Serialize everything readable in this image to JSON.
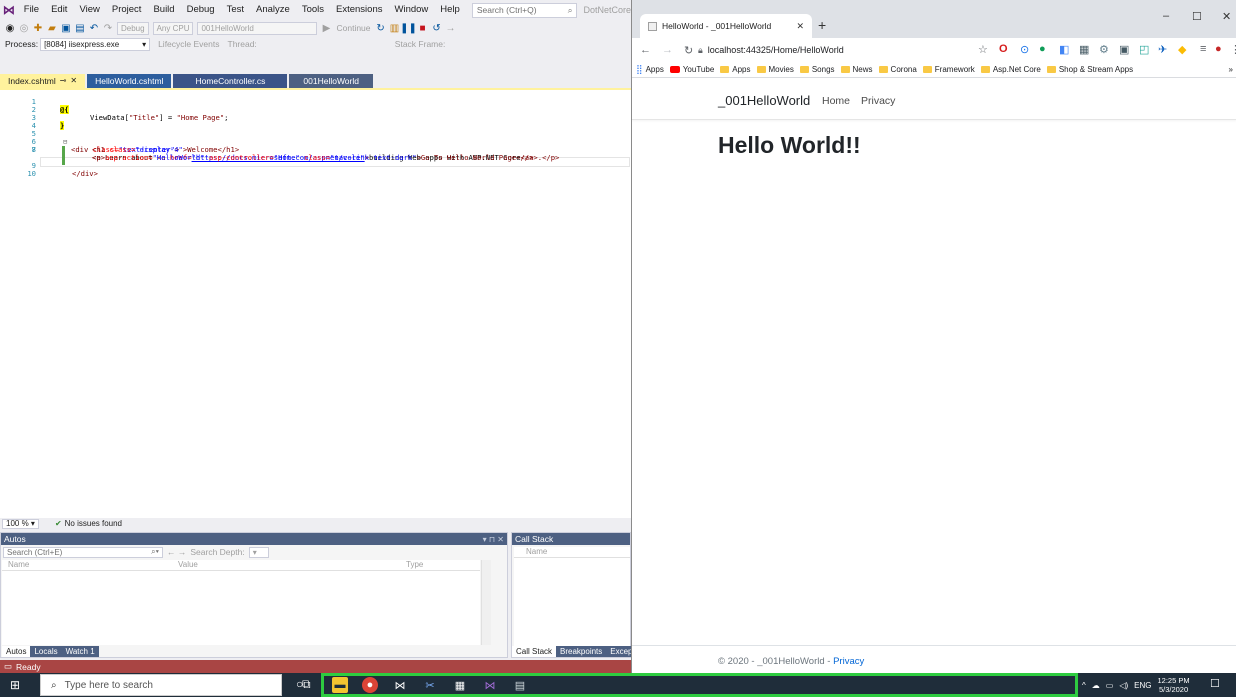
{
  "vs": {
    "menu": [
      "File",
      "Edit",
      "View",
      "Project",
      "Build",
      "Debug",
      "Test",
      "Analyze",
      "Tools",
      "Extensions",
      "Window",
      "Help"
    ],
    "search_placeholder": "Search (Ctrl+Q)",
    "solution_name": "DotNetCore",
    "toolbar": {
      "config": "Debug",
      "platform": "Any CPU",
      "project": "001HelloWorld",
      "continue_label": "Continue",
      "stack_frame": "Stack Frame:"
    },
    "debugbar": {
      "process_label": "Process:",
      "process_value": "[8084] iisexpress.exe",
      "lifecycle": "Lifecycle Events",
      "thread": "Thread:"
    },
    "tabs": [
      "Index.cshtml",
      "HelloWorld.cshtml",
      "HomeController.cs",
      "001HelloWorld"
    ],
    "code": {
      "l1": "@{",
      "l2a": "ViewData[",
      "l2b": "\"Title\"",
      "l2c": "] = ",
      "l2d": "\"Home Page\"",
      "l2e": ";",
      "l3": "}",
      "l5a": "<div ",
      "l5b": "class=",
      "l5c": "\"text-center\"",
      "l5d": ">",
      "l6a": "<h1 ",
      "l6b": "class=",
      "l6c": "\"display-4\"",
      "l6d": ">Welcome</h1>",
      "l7a": "<p>",
      "l7b": "Learn about ",
      "l7c": "<a ",
      "l7d": "href=",
      "l7e": "\"https://docs.microsoft.com/aspnet/core\"",
      "l7f": ">",
      "l7g": "building Web apps with ASP.NET Core",
      "l7h": "</a>.</p>",
      "l8a": "<a ",
      "l8b": "asp-action=",
      "l8c": "\"HelloWorld\"",
      "l8d": " asp-controller=",
      "l8e": "\"Home\"",
      "l8f": " class=",
      "l8g": "\"nav-link text-dark\"",
      "l8h": ">Go To Hello World Page</a>",
      "l9": "</div>"
    },
    "line_numbers": [
      "1",
      "2",
      "3",
      "4",
      "5",
      "6",
      "7",
      "8",
      "9",
      "10"
    ],
    "zoom": "100 %",
    "issues": "No issues found",
    "autos": {
      "title": "Autos",
      "search_placeholder": "Search (Ctrl+E)",
      "search_depth": "Search Depth:",
      "columns": [
        "Name",
        "Value",
        "Type"
      ]
    },
    "callstack": {
      "title": "Call Stack",
      "column": "Name"
    },
    "bottom_tabs_left": [
      "Autos",
      "Locals",
      "Watch 1"
    ],
    "bottom_tabs_right": [
      "Call Stack",
      "Breakpoints",
      "Exceptio"
    ],
    "status": "Ready"
  },
  "chrome": {
    "tab_title": "HelloWorld - _001HelloWorld",
    "url": "localhost:44325/Home/HelloWorld",
    "bookmarks": [
      "Apps",
      "YouTube",
      "Apps",
      "Movies",
      "Songs",
      "News",
      "Corona",
      "Framework",
      "Asp.Net Core",
      "Shop & Stream Apps"
    ],
    "more": "»"
  },
  "site": {
    "brand": "_001HelloWorld",
    "nav": [
      "Home",
      "Privacy"
    ],
    "heading": "Hello World!!",
    "footer_prefix": "© 2020 - _001HelloWorld - ",
    "footer_link": "Privacy"
  },
  "taskbar": {
    "search_placeholder": "Type here to search",
    "lang": "ENG",
    "time": "12:25 PM",
    "date": "5/3/2020"
  },
  "colors": {
    "vs_status": "#a94544",
    "vs_active_tab": "#fff29d",
    "taskbar_highlight": "#2ecc40"
  }
}
